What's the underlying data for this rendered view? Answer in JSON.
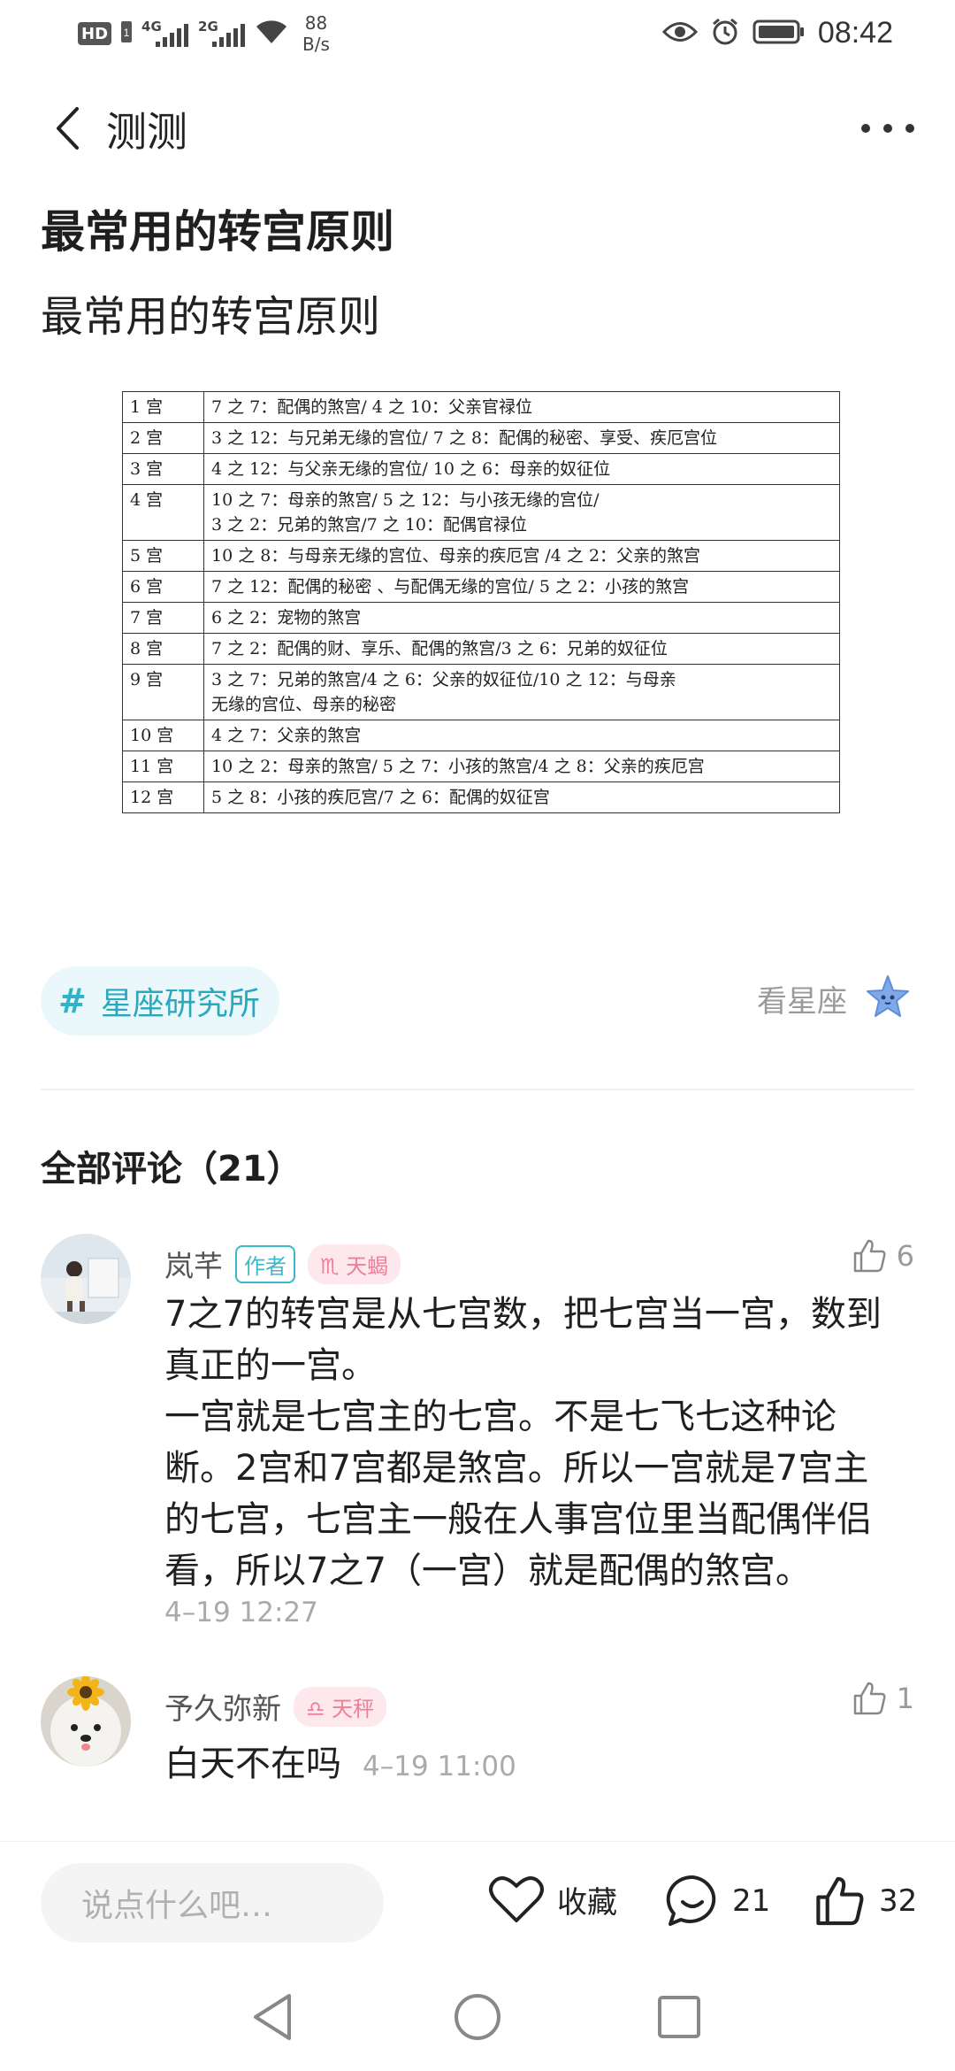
{
  "status_bar": {
    "hd_label": "HD",
    "sim1_gen": "4G",
    "sim2_gen": "2G",
    "speed_value": "88",
    "speed_unit": "B/s",
    "time": "08:42"
  },
  "header": {
    "title": "测测"
  },
  "article": {
    "title": "最常用的转宫原则",
    "subtitle": "最常用的转宫原则",
    "table_rows": [
      [
        "1 宫",
        "7 之 7：配偶的煞宫/ 4 之 10：父亲官禄位"
      ],
      [
        "2 宫",
        "3 之 12：与兄弟无缘的宫位/ 7 之 8：配偶的秘密、享受、疾厄宫位"
      ],
      [
        "3 宫",
        "4 之 12：与父亲无缘的宫位/ 10 之 6：母亲的奴征位"
      ],
      [
        "4 宫",
        "10 之 7：母亲的煞宫/ 5 之 12：与小孩无缘的宫位/\n3 之 2：兄弟的煞宫/7 之 10：配偶官禄位"
      ],
      [
        "5 宫",
        "10 之 8：与母亲无缘的宫位、母亲的疾厄宫  /4 之 2：父亲的煞宫"
      ],
      [
        "6 宫",
        "7 之 12：配偶的秘密  、与配偶无缘的宫位/ 5 之 2：小孩的煞宫"
      ],
      [
        "7 宫",
        "6 之 2：宠物的煞宫"
      ],
      [
        "8 宫",
        "7 之 2：配偶的财、享乐、配偶的煞宫/3 之 6：兄弟的奴征位"
      ],
      [
        "9 宫",
        "3 之 7：兄弟的煞宫/4 之 6：父亲的奴征位/10 之 12：与母亲\n无缘的宫位、母亲的秘密"
      ],
      [
        "10 宫",
        "4 之 7：父亲的煞宫"
      ],
      [
        "11 宫",
        "10 之 2：母亲的煞宫/ 5 之 7：小孩的煞宫/4 之 8：父亲的疾厄宫"
      ],
      [
        "12 宫",
        "5 之 8：小孩的疾厄宫/7 之 6：配偶的奴征宫"
      ]
    ]
  },
  "topic": {
    "hash": "#",
    "label": "星座研究所"
  },
  "see_star": {
    "label": "看星座",
    "icon": "star-mascot-icon"
  },
  "comments": {
    "header": "全部评论（21）",
    "items": [
      {
        "name": "岚芊",
        "author_badge": "作者",
        "zodiac": "♏ 天蝎",
        "likes": "6",
        "text": "7之7的转宫是从七宫数，把七宫当一宫，数到真正的一宫。\n一宫就是七宫主的七宫。不是七飞七这种论断。2宫和7宫都是煞宫。所以一宫就是7宫主的七宫，七宫主一般在人事宫位里当配偶伴侣看，所以7之7（一宫）就是配偶的煞宫。",
        "time": "4–19 12:27"
      },
      {
        "name": "予久弥新",
        "zodiac": "♎ 天秤",
        "likes": "1",
        "text": "白天不在吗",
        "time": "4–19 11:00"
      }
    ]
  },
  "bottom_bar": {
    "input_placeholder": "说点什么吧…",
    "collect_label": "收藏",
    "comment_count": "21",
    "like_count": "32"
  },
  "colors": {
    "accent": "#2fb3c8",
    "zodiac_pink": "#ef7e96",
    "muted": "#9a9a9a"
  }
}
